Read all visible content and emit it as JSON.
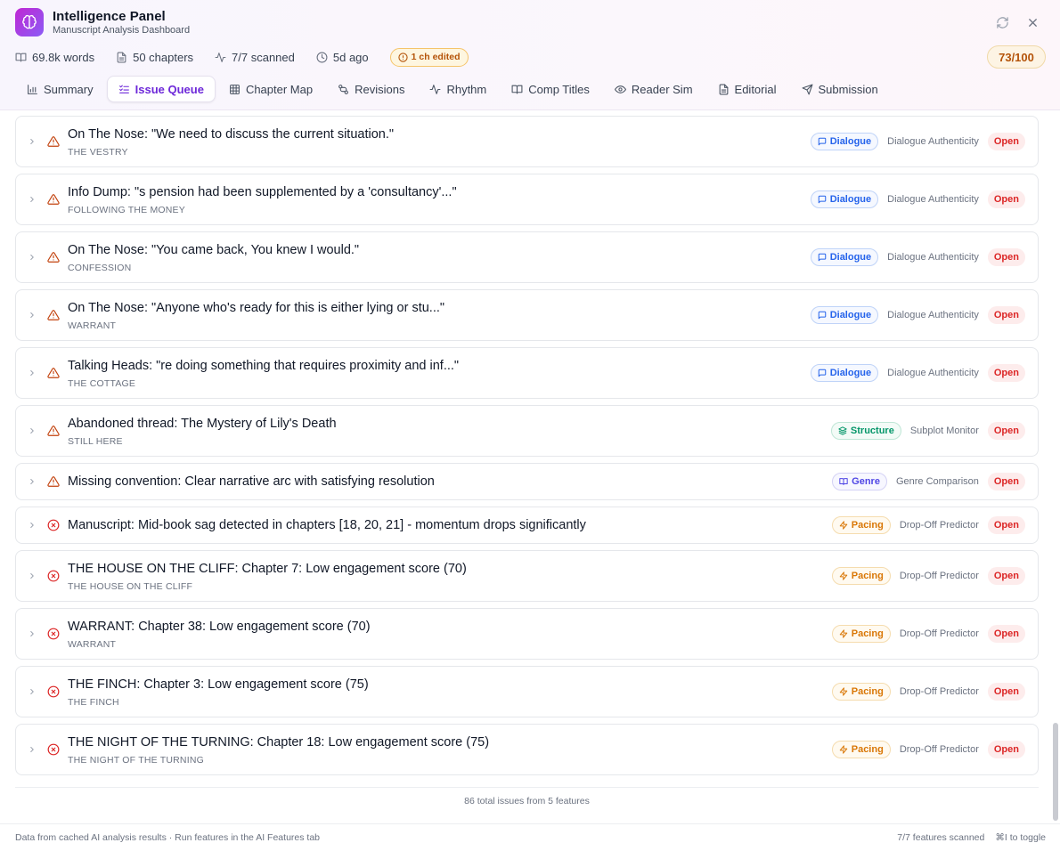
{
  "header": {
    "title": "Intelligence Panel",
    "subtitle": "Manuscript Analysis Dashboard",
    "icons": {
      "logo": "brain-icon",
      "refresh": "refresh-icon",
      "close": "close-icon"
    }
  },
  "stats": {
    "words": "69.8k words",
    "chapters": "50 chapters",
    "scanned": "7/7 scanned",
    "last_run": "5d ago",
    "edited": "1 ch edited",
    "score": "73/100"
  },
  "tabs": [
    {
      "label": "Summary",
      "icon": "bar-chart-icon"
    },
    {
      "label": "Issue Queue",
      "icon": "list-checks-icon",
      "active": true
    },
    {
      "label": "Chapter Map",
      "icon": "grid-icon"
    },
    {
      "label": "Revisions",
      "icon": "git-compare-icon"
    },
    {
      "label": "Rhythm",
      "icon": "activity-icon"
    },
    {
      "label": "Comp Titles",
      "icon": "book-open-icon"
    },
    {
      "label": "Reader Sim",
      "icon": "eye-icon"
    },
    {
      "label": "Editorial",
      "icon": "file-text-icon"
    },
    {
      "label": "Submission",
      "icon": "send-icon"
    }
  ],
  "issues": [
    {
      "title": "On The Nose: \"We need to discuss the current situation.\"",
      "chapter": "THE VESTRY",
      "category": "Dialogue",
      "feature": "Dialogue Authenticity",
      "status": "Open",
      "severity": "warning"
    },
    {
      "title": "Info Dump: \"s pension had been supplemented by a 'consultancy'...\"",
      "chapter": "FOLLOWING THE MONEY",
      "category": "Dialogue",
      "feature": "Dialogue Authenticity",
      "status": "Open",
      "severity": "warning"
    },
    {
      "title": "On The Nose: \"You came back, You knew I would.\"",
      "chapter": "CONFESSION",
      "category": "Dialogue",
      "feature": "Dialogue Authenticity",
      "status": "Open",
      "severity": "warning"
    },
    {
      "title": "On The Nose: \"Anyone who's ready for this is either lying or stu...\"",
      "chapter": "WARRANT",
      "category": "Dialogue",
      "feature": "Dialogue Authenticity",
      "status": "Open",
      "severity": "warning"
    },
    {
      "title": "Talking Heads: \"re doing something that requires proximity and inf...\"",
      "chapter": "THE COTTAGE",
      "category": "Dialogue",
      "feature": "Dialogue Authenticity",
      "status": "Open",
      "severity": "warning"
    },
    {
      "title": "Abandoned thread: The Mystery of Lily's Death",
      "chapter": "STILL HERE",
      "category": "Structure",
      "feature": "Subplot Monitor",
      "status": "Open",
      "severity": "warning"
    },
    {
      "title": "Missing convention: Clear narrative arc with satisfying resolution",
      "chapter": "",
      "category": "Genre",
      "feature": "Genre Comparison",
      "status": "Open",
      "severity": "warning"
    },
    {
      "title": "Manuscript: Mid-book sag detected in chapters [18, 20, 21] - momentum drops significantly",
      "chapter": "",
      "category": "Pacing",
      "feature": "Drop-Off Predictor",
      "status": "Open",
      "severity": "error"
    },
    {
      "title": "THE HOUSE ON THE CLIFF: Chapter 7: Low engagement score (70)",
      "chapter": "THE HOUSE ON THE CLIFF",
      "category": "Pacing",
      "feature": "Drop-Off Predictor",
      "status": "Open",
      "severity": "error"
    },
    {
      "title": "WARRANT: Chapter 38: Low engagement score (70)",
      "chapter": "WARRANT",
      "category": "Pacing",
      "feature": "Drop-Off Predictor",
      "status": "Open",
      "severity": "error"
    },
    {
      "title": "THE FINCH: Chapter 3: Low engagement score (75)",
      "chapter": "THE FINCH",
      "category": "Pacing",
      "feature": "Drop-Off Predictor",
      "status": "Open",
      "severity": "error"
    },
    {
      "title": "THE NIGHT OF THE TURNING: Chapter 18: Low engagement score (75)",
      "chapter": "THE NIGHT OF THE TURNING",
      "category": "Pacing",
      "feature": "Drop-Off Predictor",
      "status": "Open",
      "severity": "error"
    }
  ],
  "total": "86 total issues from 5 features",
  "footer": {
    "left": "Data from cached AI analysis results · Run features in the AI Features tab",
    "features_scanned": "7/7 features scanned",
    "shortcut": "⌘I to toggle"
  },
  "colors": {
    "accent": "#6d28d9",
    "warning": "#c2410c",
    "error": "#dc2626",
    "dialogue": "#2563eb",
    "structure": "#059669",
    "genre": "#4f46e5",
    "pacing": "#d97706"
  }
}
